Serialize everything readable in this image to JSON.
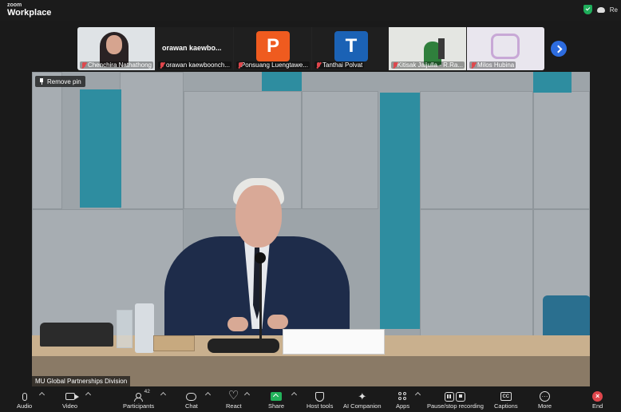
{
  "app": {
    "brand_small": "zoom",
    "brand_big": "Workplace",
    "recording_indicator": "Re"
  },
  "thumbnails": [
    {
      "name": "Chenchira Nathathong",
      "type": "video",
      "muted": true
    },
    {
      "name": "orawan kaewboonch...",
      "display_name": "orawan  kaewbo...",
      "type": "name",
      "muted": true
    },
    {
      "name": "Ponsuang Luengtawe...",
      "initial": "P",
      "avatar_color": "#ef5b1f",
      "type": "avatar",
      "muted": true
    },
    {
      "name": "Tanthai Polvat",
      "initial": "T",
      "avatar_color": "#1b62b5",
      "type": "avatar",
      "muted": true
    },
    {
      "name": "Kitisak Jaijulla - R.Ra...",
      "type": "video",
      "muted": true
    },
    {
      "name": "Milos Hubina",
      "type": "video",
      "muted": true
    }
  ],
  "main_video": {
    "remove_pin_label": "Remove pin",
    "participant_label": "MU Global Partnerships Division"
  },
  "toolbar": {
    "participant_count": "42",
    "items": [
      {
        "label": "Audio",
        "icon": "microphone-icon"
      },
      {
        "label": "Video",
        "icon": "video-camera-icon"
      },
      {
        "label": "Participants",
        "icon": "participants-icon"
      },
      {
        "label": "Chat",
        "icon": "chat-icon"
      },
      {
        "label": "React",
        "icon": "heart-icon"
      },
      {
        "label": "Share",
        "icon": "share-screen-icon",
        "color": "#23b35b"
      },
      {
        "label": "Host tools",
        "icon": "shield-icon"
      },
      {
        "label": "AI Companion",
        "icon": "sparkle-icon"
      },
      {
        "label": "Apps",
        "icon": "apps-icon"
      },
      {
        "label": "Pause/stop recording",
        "icon": "pause-stop-icon"
      },
      {
        "label": "Captions",
        "icon": "captions-icon"
      },
      {
        "label": "More",
        "icon": "more-icon"
      },
      {
        "label": "End",
        "icon": "end-icon",
        "color": "#e0464c"
      }
    ]
  }
}
